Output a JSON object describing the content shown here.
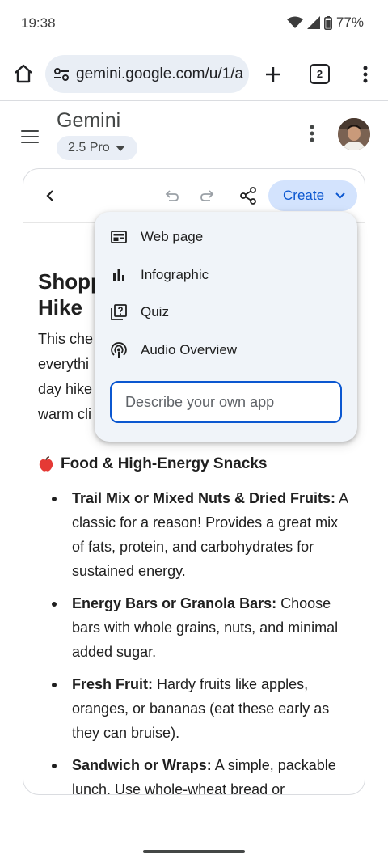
{
  "status_bar": {
    "time": "19:38",
    "battery": "77%",
    "icons": [
      "wifi-icon",
      "signal-icon",
      "battery-icon"
    ]
  },
  "browser": {
    "url": "gemini.google.com/u/1/a",
    "tab_count": "2",
    "icons": [
      "home-icon",
      "site-settings-icon",
      "plus-icon",
      "more-vert-icon"
    ]
  },
  "header": {
    "title": "Gemini",
    "model": "2.5 Pro"
  },
  "canvas": {
    "create_label": "Create",
    "title": "Shopp\nHike",
    "intro_lines": [
      "This che",
      "everythi",
      "day hike",
      "warm cli"
    ],
    "section_title": "Food & High-Energy Snacks",
    "items": [
      {
        "bold": "Trail Mix or Mixed Nuts & Dried Fruits:",
        "text": " A classic for a reason! Provides a great mix of fats, protein, and carbohydrates for sustained energy."
      },
      {
        "bold": "Energy Bars or Granola Bars:",
        "text": " Choose bars with whole grains, nuts, and minimal added sugar."
      },
      {
        "bold": "Fresh Fruit:",
        "text": " Hardy fruits like apples, oranges, or bananas (eat these early as they can bruise)."
      },
      {
        "bold": "Sandwich or Wraps:",
        "text": " A simple, packable lunch. Use whole-wheat bread or"
      }
    ]
  },
  "create_menu": {
    "items": [
      {
        "label": "Web page",
        "icon": "web-page-icon"
      },
      {
        "label": "Infographic",
        "icon": "infographic-icon"
      },
      {
        "label": "Quiz",
        "icon": "quiz-icon"
      },
      {
        "label": "Audio Overview",
        "icon": "podcast-icon"
      }
    ],
    "input_placeholder": "Describe your own app"
  },
  "colors": {
    "accent": "#0b57d0",
    "chip_bg": "#d3e3fd",
    "menu_bg": "#f0f4f9"
  }
}
